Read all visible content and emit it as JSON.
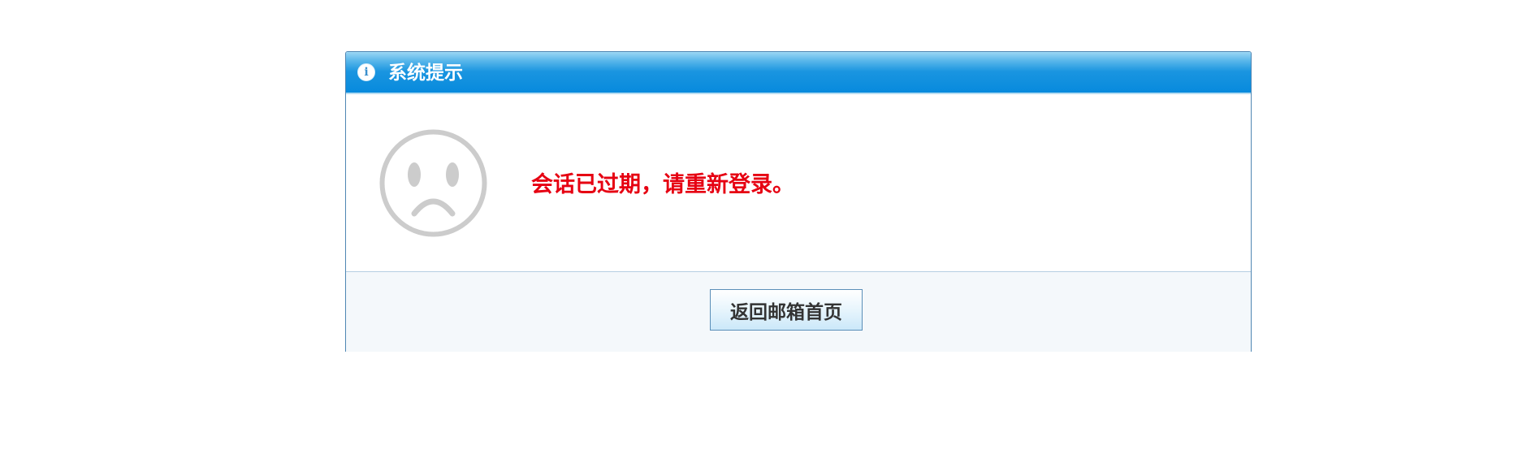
{
  "dialog": {
    "title": "系统提示",
    "icon": "info-icon",
    "face_icon": "sad-face-icon",
    "message": "会话已过期，请重新登录。",
    "button_label": "返回邮箱首页"
  },
  "colors": {
    "title_bar": "#078add",
    "message": "#e60012",
    "border": "#4f86b3",
    "footer_bg": "#f4f8fb",
    "face": "#cccccc"
  }
}
